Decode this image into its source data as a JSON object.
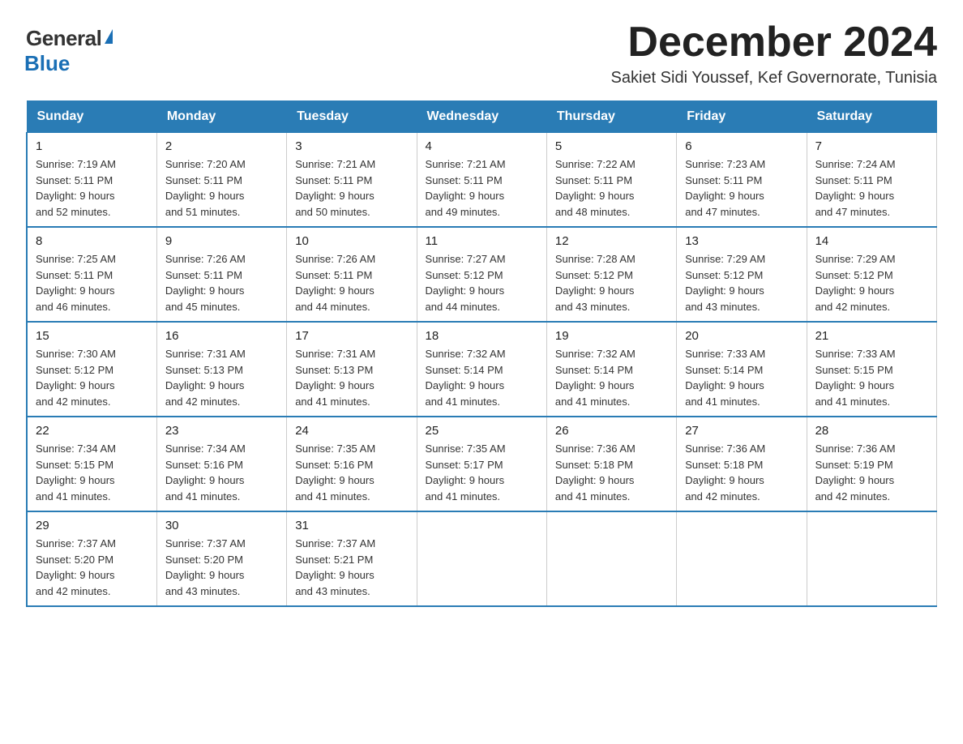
{
  "logo": {
    "general": "General",
    "blue": "Blue"
  },
  "title": "December 2024",
  "subtitle": "Sakiet Sidi Youssef, Kef Governorate, Tunisia",
  "days_of_week": [
    "Sunday",
    "Monday",
    "Tuesday",
    "Wednesday",
    "Thursday",
    "Friday",
    "Saturday"
  ],
  "weeks": [
    [
      {
        "day": "1",
        "sunrise": "7:19 AM",
        "sunset": "5:11 PM",
        "daylight": "9 hours and 52 minutes."
      },
      {
        "day": "2",
        "sunrise": "7:20 AM",
        "sunset": "5:11 PM",
        "daylight": "9 hours and 51 minutes."
      },
      {
        "day": "3",
        "sunrise": "7:21 AM",
        "sunset": "5:11 PM",
        "daylight": "9 hours and 50 minutes."
      },
      {
        "day": "4",
        "sunrise": "7:21 AM",
        "sunset": "5:11 PM",
        "daylight": "9 hours and 49 minutes."
      },
      {
        "day": "5",
        "sunrise": "7:22 AM",
        "sunset": "5:11 PM",
        "daylight": "9 hours and 48 minutes."
      },
      {
        "day": "6",
        "sunrise": "7:23 AM",
        "sunset": "5:11 PM",
        "daylight": "9 hours and 47 minutes."
      },
      {
        "day": "7",
        "sunrise": "7:24 AM",
        "sunset": "5:11 PM",
        "daylight": "9 hours and 47 minutes."
      }
    ],
    [
      {
        "day": "8",
        "sunrise": "7:25 AM",
        "sunset": "5:11 PM",
        "daylight": "9 hours and 46 minutes."
      },
      {
        "day": "9",
        "sunrise": "7:26 AM",
        "sunset": "5:11 PM",
        "daylight": "9 hours and 45 minutes."
      },
      {
        "day": "10",
        "sunrise": "7:26 AM",
        "sunset": "5:11 PM",
        "daylight": "9 hours and 44 minutes."
      },
      {
        "day": "11",
        "sunrise": "7:27 AM",
        "sunset": "5:12 PM",
        "daylight": "9 hours and 44 minutes."
      },
      {
        "day": "12",
        "sunrise": "7:28 AM",
        "sunset": "5:12 PM",
        "daylight": "9 hours and 43 minutes."
      },
      {
        "day": "13",
        "sunrise": "7:29 AM",
        "sunset": "5:12 PM",
        "daylight": "9 hours and 43 minutes."
      },
      {
        "day": "14",
        "sunrise": "7:29 AM",
        "sunset": "5:12 PM",
        "daylight": "9 hours and 42 minutes."
      }
    ],
    [
      {
        "day": "15",
        "sunrise": "7:30 AM",
        "sunset": "5:12 PM",
        "daylight": "9 hours and 42 minutes."
      },
      {
        "day": "16",
        "sunrise": "7:31 AM",
        "sunset": "5:13 PM",
        "daylight": "9 hours and 42 minutes."
      },
      {
        "day": "17",
        "sunrise": "7:31 AM",
        "sunset": "5:13 PM",
        "daylight": "9 hours and 41 minutes."
      },
      {
        "day": "18",
        "sunrise": "7:32 AM",
        "sunset": "5:14 PM",
        "daylight": "9 hours and 41 minutes."
      },
      {
        "day": "19",
        "sunrise": "7:32 AM",
        "sunset": "5:14 PM",
        "daylight": "9 hours and 41 minutes."
      },
      {
        "day": "20",
        "sunrise": "7:33 AM",
        "sunset": "5:14 PM",
        "daylight": "9 hours and 41 minutes."
      },
      {
        "day": "21",
        "sunrise": "7:33 AM",
        "sunset": "5:15 PM",
        "daylight": "9 hours and 41 minutes."
      }
    ],
    [
      {
        "day": "22",
        "sunrise": "7:34 AM",
        "sunset": "5:15 PM",
        "daylight": "9 hours and 41 minutes."
      },
      {
        "day": "23",
        "sunrise": "7:34 AM",
        "sunset": "5:16 PM",
        "daylight": "9 hours and 41 minutes."
      },
      {
        "day": "24",
        "sunrise": "7:35 AM",
        "sunset": "5:16 PM",
        "daylight": "9 hours and 41 minutes."
      },
      {
        "day": "25",
        "sunrise": "7:35 AM",
        "sunset": "5:17 PM",
        "daylight": "9 hours and 41 minutes."
      },
      {
        "day": "26",
        "sunrise": "7:36 AM",
        "sunset": "5:18 PM",
        "daylight": "9 hours and 41 minutes."
      },
      {
        "day": "27",
        "sunrise": "7:36 AM",
        "sunset": "5:18 PM",
        "daylight": "9 hours and 42 minutes."
      },
      {
        "day": "28",
        "sunrise": "7:36 AM",
        "sunset": "5:19 PM",
        "daylight": "9 hours and 42 minutes."
      }
    ],
    [
      {
        "day": "29",
        "sunrise": "7:37 AM",
        "sunset": "5:20 PM",
        "daylight": "9 hours and 42 minutes."
      },
      {
        "day": "30",
        "sunrise": "7:37 AM",
        "sunset": "5:20 PM",
        "daylight": "9 hours and 43 minutes."
      },
      {
        "day": "31",
        "sunrise": "7:37 AM",
        "sunset": "5:21 PM",
        "daylight": "9 hours and 43 minutes."
      },
      null,
      null,
      null,
      null
    ]
  ],
  "labels": {
    "sunrise": "Sunrise:",
    "sunset": "Sunset:",
    "daylight": "Daylight:"
  }
}
